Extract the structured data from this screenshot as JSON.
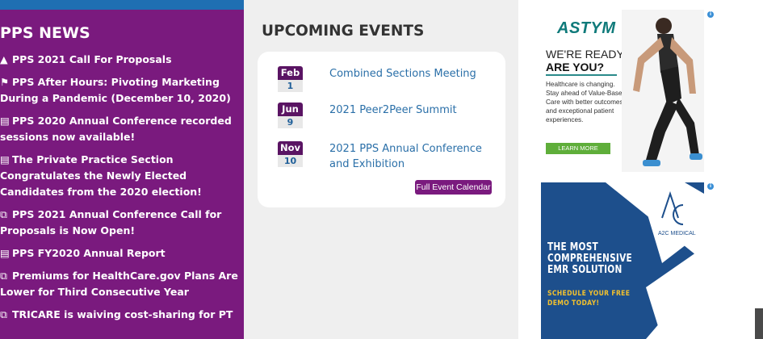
{
  "news": {
    "title": "PPS NEWS",
    "items": [
      {
        "icon": "warning-icon",
        "glyph": "▲",
        "text": "PPS 2021 Call For Proposals"
      },
      {
        "icon": "flag-icon",
        "glyph": "⚑",
        "text": "PPS After Hours: Pivoting Marketing During a Pandemic (December 10, 2020)"
      },
      {
        "icon": "newspaper-icon",
        "glyph": "▤",
        "text": "PPS 2020 Annual Conference recorded sessions now available!"
      },
      {
        "icon": "newspaper-icon",
        "glyph": "▤",
        "text": "The Private Practice Section Congratulates the Newly Elected Candidates from the 2020 election!"
      },
      {
        "icon": "external-link-icon",
        "glyph": "⧉",
        "text": "PPS 2021 Annual Conference Call for Proposals is Now Open!"
      },
      {
        "icon": "newspaper-icon",
        "glyph": "▤",
        "text": "PPS FY2020 Annual Report"
      },
      {
        "icon": "external-link-icon",
        "glyph": "⧉",
        "text": "Premiums for HealthCare.gov Plans Are Lower for Third Consecutive Year"
      },
      {
        "icon": "external-link-icon",
        "glyph": "⧉",
        "text": "TRICARE is waiving cost-sharing for PT"
      }
    ]
  },
  "events": {
    "title": "UPCOMING EVENTS",
    "items": [
      {
        "month": "Feb",
        "day": "1",
        "name": "Combined Sections Meeting"
      },
      {
        "month": "Jun",
        "day": "9",
        "name": "2021 Peer2Peer Summit"
      },
      {
        "month": "Nov",
        "day": "10",
        "name": "2021 PPS Annual Conference and Exhibition"
      }
    ],
    "calendar_button": "Full Event Calendar"
  },
  "ads": {
    "info_glyph": "i",
    "astym": {
      "logo": "ASTYM",
      "headline1": "WE'RE READY.",
      "headline2": "ARE YOU?",
      "body": "Healthcare is changing. Stay ahead of Value-Based Care with better outcomes and exceptional patient experiences.",
      "button": "LEARN MORE"
    },
    "a2c": {
      "logo_text": "A2C MEDICAL",
      "headline": "THE MOST COMPREHENSIVE EMR SOLUTION",
      "subline": "SCHEDULE YOUR FREE DEMO TODAY!"
    }
  },
  "colors": {
    "news_bg": "#7a1a7e",
    "news_topbar": "#1f6fb2",
    "event_link": "#2a6fa8",
    "month_badge": "#5a1463",
    "ad_green": "#5fae3a",
    "ad_blue": "#1d4f8c",
    "ad_yellow": "#f2c12e"
  }
}
